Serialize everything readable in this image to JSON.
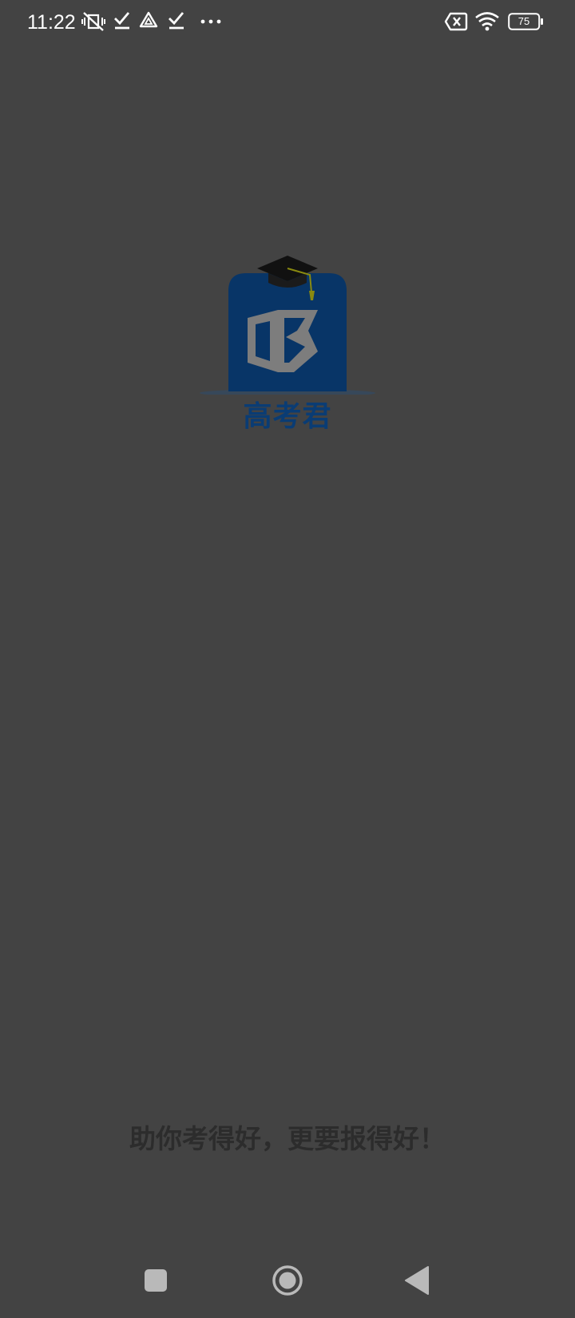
{
  "status_bar": {
    "time": "11:22",
    "battery_level": "75",
    "icons": [
      "vibrate-off-icon",
      "download-check-icon",
      "drive-icon",
      "download-check-icon",
      "more-dots-icon",
      "sim-error-icon",
      "wifi-icon",
      "battery-icon"
    ]
  },
  "splash": {
    "app_name": "高考君",
    "slogan": "助你考得好，更要报得好！"
  },
  "nav_bar": {
    "buttons": [
      "recents-button",
      "home-button",
      "back-button"
    ]
  },
  "colors": {
    "background": "#434343",
    "logo_blue": "#0a3c74",
    "slogan": "#2c2c2c"
  }
}
